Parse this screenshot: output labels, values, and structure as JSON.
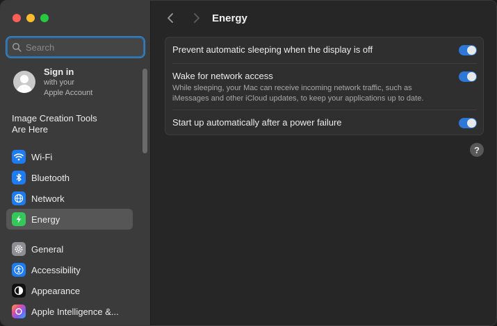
{
  "search": {
    "placeholder": "Search"
  },
  "account": {
    "title": "Sign in",
    "subtitle_line1": "with your",
    "subtitle_line2": "Apple Account"
  },
  "promo": {
    "line1": "Image Creation Tools",
    "line2": "Are Here"
  },
  "sidebar": {
    "items": [
      {
        "label": "Wi-Fi",
        "icon": "wifi-icon",
        "color": "#1e7cf2"
      },
      {
        "label": "Bluetooth",
        "icon": "bluetooth-icon",
        "color": "#1e7cf2"
      },
      {
        "label": "Network",
        "icon": "globe-icon",
        "color": "#1e7cf2"
      },
      {
        "label": "Energy",
        "icon": "bolt-icon",
        "color": "#34c759",
        "selected": true
      },
      {
        "label": "General",
        "icon": "gear-icon",
        "color": "#8e8e93"
      },
      {
        "label": "Accessibility",
        "icon": "accessibility-icon",
        "color": "#1e7cf2"
      },
      {
        "label": "Appearance",
        "icon": "appearance-icon",
        "color": "#111111"
      },
      {
        "label": "Apple Intelligence &...",
        "icon": "apple-intelligence-icon",
        "color": "#e44d9a"
      }
    ]
  },
  "header": {
    "title": "Energy"
  },
  "settings": {
    "rows": [
      {
        "title": "Prevent automatic sleeping when the display is off",
        "description": "",
        "enabled": true
      },
      {
        "title": "Wake for network access",
        "description": "While sleeping, your Mac can receive incoming network traffic, such as iMessages and other iCloud updates, to keep your applications up to date.",
        "enabled": true
      },
      {
        "title": "Start up automatically after a power failure",
        "description": "",
        "enabled": true
      }
    ]
  },
  "help": {
    "label": "?"
  },
  "colors": {
    "accent": "#2d78d6",
    "selection": "#565656"
  }
}
